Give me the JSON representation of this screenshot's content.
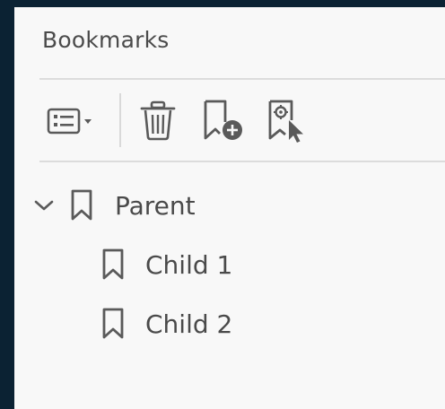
{
  "panel": {
    "title": "Bookmarks"
  },
  "toolbar": {
    "options_icon": "options-list-icon",
    "delete_icon": "trash-icon",
    "new_bookmark_icon": "new-bookmark-icon",
    "bookmark_at_cursor_icon": "bookmark-cursor-icon"
  },
  "tree": {
    "parent": {
      "label": "Parent",
      "expanded": true
    },
    "children": [
      {
        "label": "Child 1"
      },
      {
        "label": "Child 2"
      }
    ]
  },
  "colors": {
    "window_frame": "#0b2233",
    "panel_background": "#f8f8f8",
    "icon": "#5a5a5a",
    "text": "#4a4a4a",
    "separator": "#dcdcdc"
  }
}
